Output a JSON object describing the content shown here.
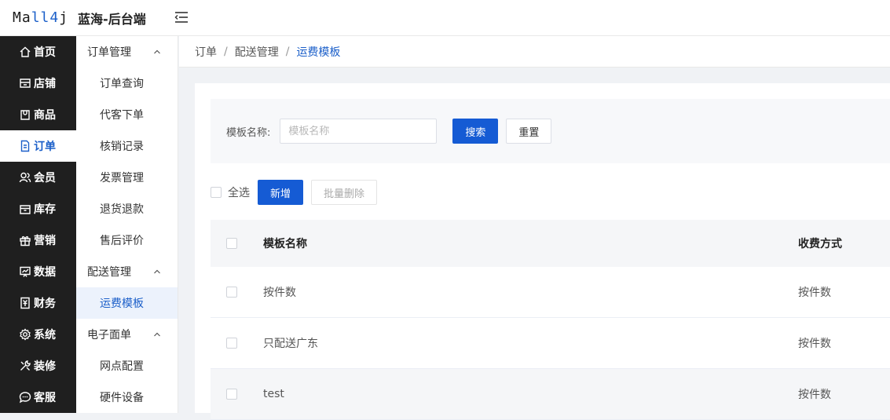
{
  "header": {
    "logo_prefix": "Ma",
    "logo_accent": "ll4",
    "logo_suffix": "j",
    "title": "蓝海-后台端"
  },
  "sidebar": {
    "items": [
      {
        "label": "首页",
        "icon": "home-icon"
      },
      {
        "label": "店铺",
        "icon": "shop-icon"
      },
      {
        "label": "商品",
        "icon": "bag-icon"
      },
      {
        "label": "订单",
        "icon": "document-icon"
      },
      {
        "label": "会员",
        "icon": "users-icon"
      },
      {
        "label": "库存",
        "icon": "box-icon"
      },
      {
        "label": "营销",
        "icon": "gift-icon"
      },
      {
        "label": "数据",
        "icon": "chart-icon"
      },
      {
        "label": "财务",
        "icon": "finance-icon"
      },
      {
        "label": "系统",
        "icon": "gear-icon"
      },
      {
        "label": "装修",
        "icon": "tools-icon"
      },
      {
        "label": "客服",
        "icon": "chat-icon"
      }
    ],
    "active_index": 3
  },
  "submenu": {
    "group1": "订单管理",
    "group1_items": [
      "订单查询",
      "代客下单",
      "核销记录",
      "发票管理",
      "退货退款",
      "售后评价"
    ],
    "group2": "配送管理",
    "group2_items": [
      "运费模板"
    ],
    "group3": "电子面单",
    "group3_items": [
      "网点配置",
      "硬件设备"
    ]
  },
  "breadcrumb": {
    "items": [
      "订单",
      "配送管理",
      "运费模板"
    ],
    "separator": "/"
  },
  "search": {
    "label": "模板名称:",
    "placeholder": "模板名称",
    "search_button": "搜索",
    "reset_button": "重置"
  },
  "toolbar": {
    "select_all": "全选",
    "add_button": "新增",
    "batch_delete": "批量删除"
  },
  "table": {
    "columns": [
      "模板名称",
      "收费方式"
    ],
    "rows": [
      {
        "name": "按件数",
        "type": "按件数"
      },
      {
        "name": "只配送广东",
        "type": "按件数"
      },
      {
        "name": "test",
        "type": "按件数"
      }
    ]
  },
  "colors": {
    "primary": "#155bd4",
    "sidebar_bg": "#1f1f1f",
    "submenu_active_bg": "#ecf2fc"
  }
}
